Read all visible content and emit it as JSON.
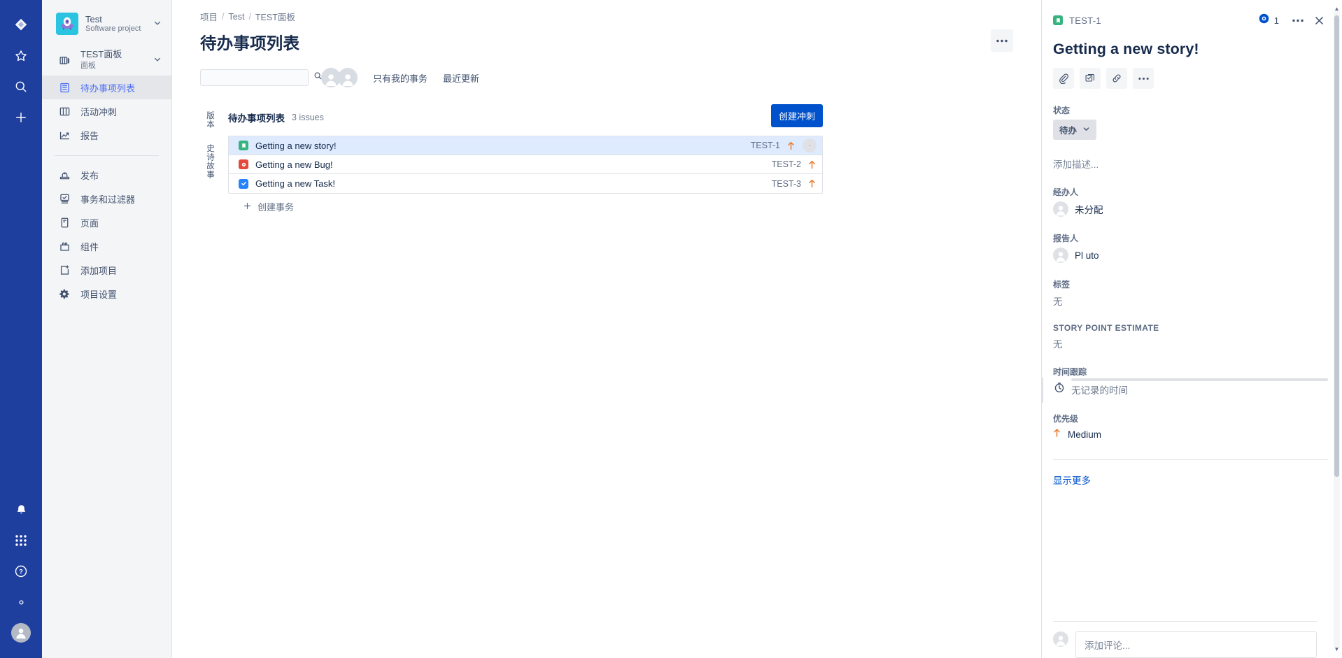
{
  "rail": {
    "items": [
      {
        "name": "jira-logo-icon",
        "label": "Jira"
      },
      {
        "name": "starred-icon",
        "label": "收藏"
      },
      {
        "name": "search-icon",
        "label": "搜索"
      },
      {
        "name": "create-icon",
        "label": "创建"
      }
    ],
    "bottom": [
      {
        "name": "notifications-icon",
        "label": "通知"
      },
      {
        "name": "apps-grid-icon",
        "label": "应用"
      },
      {
        "name": "help-icon",
        "label": "帮助"
      },
      {
        "name": "settings-icon",
        "label": "设置"
      },
      {
        "name": "profile-avatar",
        "label": "个人资料"
      }
    ]
  },
  "sidebar": {
    "project": {
      "name": "Test",
      "subtitle": "Software project"
    },
    "board": {
      "title": "TEST面板",
      "subtitle": "面板"
    },
    "items": [
      {
        "label": "待办事项列表",
        "icon": "backlog-icon",
        "active": true
      },
      {
        "label": "活动冲刺",
        "icon": "board-columns-icon",
        "active": false
      },
      {
        "label": "报告",
        "icon": "reports-chart-icon",
        "active": false
      }
    ],
    "items2": [
      {
        "label": "发布",
        "icon": "releases-icon"
      },
      {
        "label": "事务和过滤器",
        "icon": "issues-filters-icon"
      },
      {
        "label": "页面",
        "icon": "pages-icon"
      },
      {
        "label": "组件",
        "icon": "components-icon"
      },
      {
        "label": "添加项目",
        "icon": "add-item-icon"
      },
      {
        "label": "项目设置",
        "icon": "project-settings-gear-icon"
      }
    ]
  },
  "header": {
    "breadcrumb": [
      "项目",
      "Test",
      "TEST面板"
    ],
    "title": "待办事项列表",
    "more_label": "•••"
  },
  "toolbar": {
    "search_value": "",
    "search_placeholder": "",
    "filters": [
      "只有我的事务",
      "最近更新"
    ]
  },
  "backlog": {
    "vertical_labels": [
      "版本",
      "史诗故事"
    ],
    "title": "待办事项列表",
    "count": "3 issues",
    "create_sprint_label": "创建冲刺",
    "create_issue_label": "创建事务",
    "issues": [
      {
        "type": "story",
        "summary": "Getting a new story!",
        "key": "TEST-1",
        "priority": "Medium",
        "selected": true,
        "assignee_initial": "·"
      },
      {
        "type": "bug",
        "summary": "Getting a new Bug!",
        "key": "TEST-2",
        "priority": "Medium",
        "selected": false,
        "assignee_initial": ""
      },
      {
        "type": "task",
        "summary": "Getting a new Task!",
        "key": "TEST-3",
        "priority": "Medium",
        "selected": false,
        "assignee_initial": ""
      }
    ]
  },
  "detail": {
    "key": "TEST-1",
    "watch_count": "1",
    "more_label": "•••",
    "title": "Getting a new story!",
    "actions": [
      "attach-icon",
      "child-issue-icon",
      "link-icon",
      "more-icon"
    ],
    "status_label": "状态",
    "status_value": "待办",
    "description_placeholder": "添加描述...",
    "assignee_label": "经办人",
    "assignee_value": "未分配",
    "reporter_label": "报告人",
    "reporter_value": "Pl uto",
    "labels_label": "标签",
    "labels_value": "无",
    "story_points_label": "STORY POINT ESTIMATE",
    "story_points_value": "无",
    "time_tracking_label": "时间跟踪",
    "time_tracking_value": "无记录的时间",
    "priority_label": "优先级",
    "priority_value": "Medium",
    "show_more_label": "显示更多",
    "comment_placeholder": "添加评论..."
  },
  "colors": {
    "rail_blue": "#1e3f9e",
    "primary_blue": "#0052cc",
    "story_green": "#36b37e",
    "bug_red": "#e5493a",
    "task_blue": "#2684ff",
    "priority_orange": "#e97f33",
    "selected_row": "#deebff"
  }
}
